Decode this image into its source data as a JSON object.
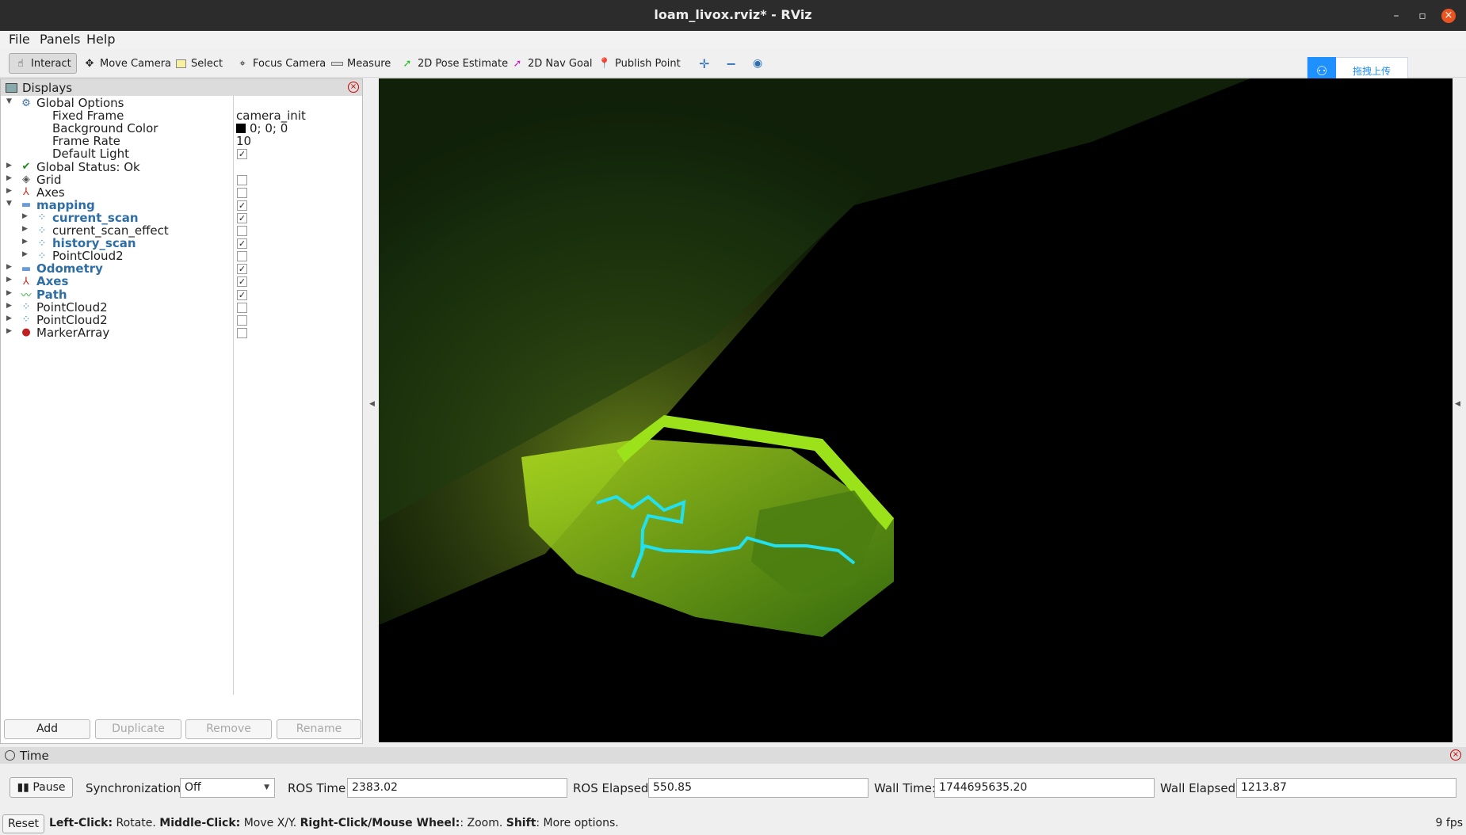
{
  "window": {
    "title": "loam_livox.rviz* - RViz"
  },
  "menu": [
    "File",
    "Panels",
    "Help"
  ],
  "toolbar": {
    "tools": [
      {
        "label": "Interact",
        "icon": "hand-cursor-icon",
        "active": true
      },
      {
        "label": "Move Camera",
        "icon": "move-camera-icon"
      },
      {
        "label": "Select",
        "icon": "select-box-icon"
      },
      {
        "label": "Focus Camera",
        "icon": "focus-camera-icon"
      },
      {
        "label": "Measure",
        "icon": "ruler-icon"
      },
      {
        "label": "2D Pose Estimate",
        "icon": "pose-arrow-icon"
      },
      {
        "label": "2D Nav Goal",
        "icon": "nav-goal-arrow-icon"
      },
      {
        "label": "Publish Point",
        "icon": "map-pin-icon"
      }
    ],
    "extras": [
      "plus-icon",
      "minus-icon",
      "eye-icon"
    ]
  },
  "overlay": {
    "upload_label": "拖拽上传",
    "icon": "cloud-share-icon"
  },
  "displays": {
    "title": "Displays",
    "rows": [
      {
        "label": "Global Options",
        "indent": 0,
        "expanded": true,
        "icon": "gear-icon"
      },
      {
        "label": "Fixed Frame",
        "indent": 1,
        "value": "camera_init"
      },
      {
        "label": "Background Color",
        "indent": 1,
        "value": "0; 0; 0",
        "swatch": "#000000"
      },
      {
        "label": "Frame Rate",
        "indent": 1,
        "value": "10"
      },
      {
        "label": "Default Light",
        "indent": 1,
        "checked": true
      },
      {
        "label": "Global Status: Ok",
        "indent": 0,
        "collapsed": true,
        "icon": "check-icon"
      },
      {
        "label": "Grid",
        "indent": 0,
        "collapsed": true,
        "icon": "grid-icon",
        "checked": false
      },
      {
        "label": "Axes",
        "indent": 0,
        "collapsed": true,
        "icon": "axes-icon",
        "checked": false
      },
      {
        "label": "mapping",
        "indent": 0,
        "expanded": true,
        "icon": "folder-icon",
        "checked": true,
        "bold": true
      },
      {
        "label": "current_scan",
        "indent": 1,
        "collapsed": true,
        "icon": "pointcloud-icon",
        "checked": true,
        "bold": true
      },
      {
        "label": "current_scan_effect",
        "indent": 1,
        "collapsed": true,
        "icon": "pointcloud-icon",
        "checked": false
      },
      {
        "label": "history_scan",
        "indent": 1,
        "collapsed": true,
        "icon": "pointcloud-icon",
        "checked": true,
        "bold": true
      },
      {
        "label": "PointCloud2",
        "indent": 1,
        "collapsed": true,
        "icon": "pointcloud-icon",
        "checked": false
      },
      {
        "label": "Odometry",
        "indent": 0,
        "collapsed": true,
        "icon": "folder-icon",
        "checked": true,
        "bold": true
      },
      {
        "label": "Axes",
        "indent": 0,
        "collapsed": true,
        "icon": "axes-icon",
        "checked": true,
        "bold": true
      },
      {
        "label": "Path",
        "indent": 0,
        "collapsed": true,
        "icon": "path-icon",
        "checked": true,
        "bold": true
      },
      {
        "label": "PointCloud2",
        "indent": 0,
        "collapsed": true,
        "icon": "pointcloud-icon",
        "checked": false
      },
      {
        "label": "PointCloud2",
        "indent": 0,
        "collapsed": true,
        "icon": "pointcloud-icon",
        "checked": false
      },
      {
        "label": "MarkerArray",
        "indent": 0,
        "collapsed": true,
        "icon": "marker-array-icon",
        "checked": false
      }
    ],
    "buttons": [
      {
        "label": "Add",
        "enabled": true
      },
      {
        "label": "Duplicate",
        "enabled": false
      },
      {
        "label": "Remove",
        "enabled": false
      },
      {
        "label": "Rename",
        "enabled": false
      }
    ]
  },
  "time": {
    "title": "Time",
    "pause_label": "Pause",
    "sync_label": "Synchronization:",
    "sync_value": "Off",
    "ros_time_label": "ROS Time:",
    "ros_time": "2383.02",
    "ros_elapsed_label": "ROS Elapsed:",
    "ros_elapsed": "550.85",
    "wall_time_label": "Wall Time:",
    "wall_time": "1744695635.20",
    "wall_elapsed_label": "Wall Elapsed:",
    "wall_elapsed": "1213.87"
  },
  "status": {
    "reset_label": "Reset",
    "hints": [
      {
        "key": "Left-Click:",
        "text": " Rotate. "
      },
      {
        "key": "Middle-Click:",
        "text": " Move X/Y. "
      },
      {
        "key": "Right-Click/Mouse Wheel:",
        "text": ": Zoom. "
      },
      {
        "key": "Shift",
        "text": ": More options."
      }
    ],
    "fps": "9 fps"
  },
  "colors": {
    "accent": "#2f6ea5",
    "path": "#22e0f0",
    "cloud": "#9ddf1a",
    "bg": "#000000"
  }
}
